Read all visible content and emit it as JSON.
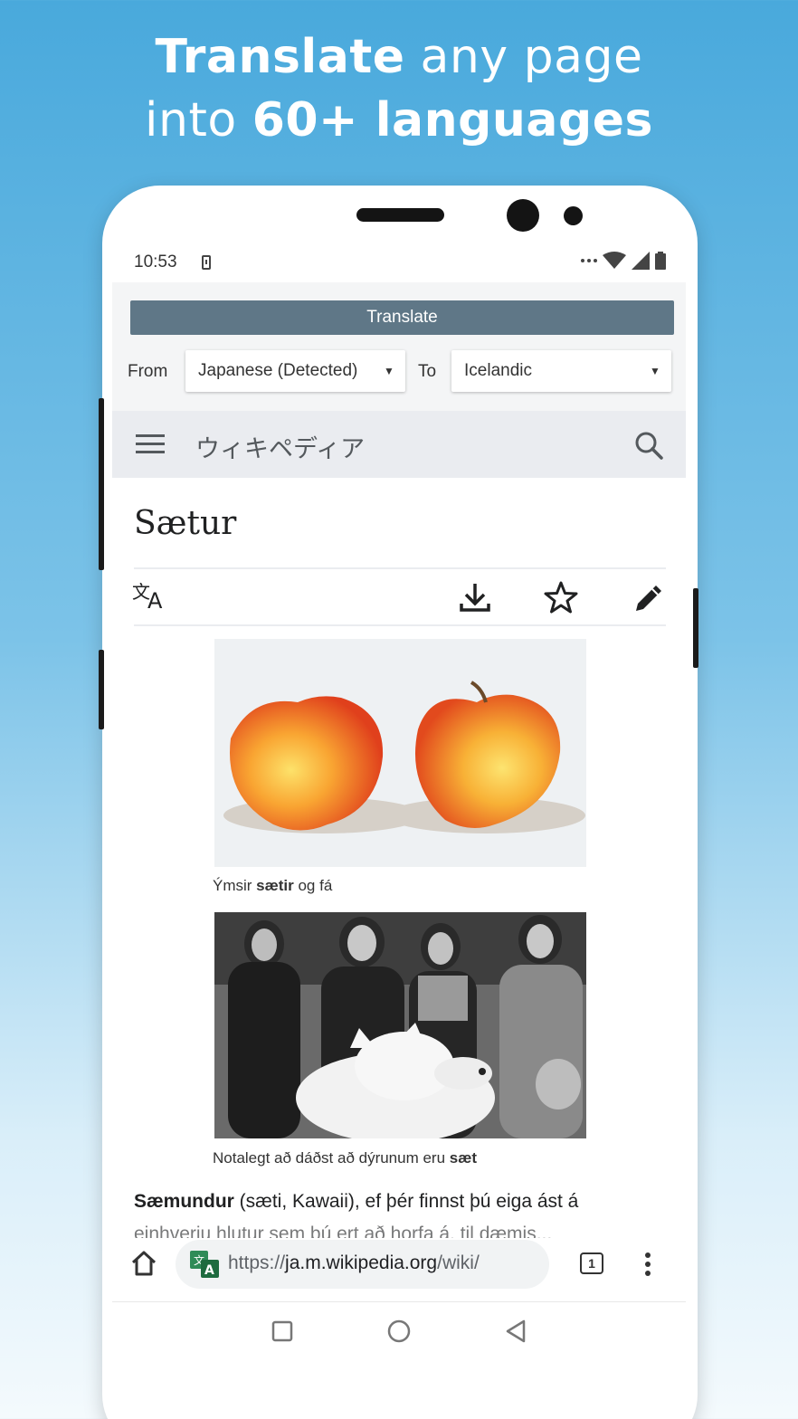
{
  "promo": {
    "line1_bold": "Translate",
    "line1_light": " any page",
    "line2_light": "into ",
    "line2_bold": "60+ languages"
  },
  "status_bar": {
    "time": "10:53",
    "icons": [
      "sim-icon",
      "more-dots-icon",
      "wifi-icon",
      "signal-icon",
      "battery-icon"
    ]
  },
  "translate_panel": {
    "button_label": "Translate",
    "from_label": "From",
    "from_value": "Japanese (Detected)",
    "to_label": "To",
    "to_value": "Icelandic"
  },
  "wiki_header": {
    "title": "ウィキペディア",
    "icons": [
      "menu-icon",
      "search-icon"
    ]
  },
  "article": {
    "title": "Sætur",
    "toolbar_icons": [
      "language-icon",
      "download-icon",
      "star-icon",
      "edit-icon"
    ],
    "caption1_pre": "Ýmsir ",
    "caption1_bold": "sætir",
    "caption1_post": " og fá",
    "caption2_pre": "Notalegt að dáðst að dýrunum eru ",
    "caption2_bold": "sæt",
    "para_bold": "Sæmundur",
    "para_rest": " (sæti, Kawaii), ef þér finnst þú eiga ást á",
    "para_cutoff": "einhverju hlutur sem þú ert að horfa á, til dæmis..."
  },
  "browser": {
    "url_scheme": "https://",
    "url_host": "ja.m.wikipedia.org",
    "url_path": "/wiki/",
    "tab_count": "1",
    "icons": [
      "home-icon",
      "translate-badge-icon",
      "overflow-menu-icon"
    ]
  },
  "nav": {
    "icons": [
      "recents-icon",
      "home-circle-icon",
      "back-icon"
    ]
  },
  "colors": {
    "bg_top": "#49a9dc",
    "translate_button": "#5f7787",
    "wiki_header": "#eaecf0"
  }
}
